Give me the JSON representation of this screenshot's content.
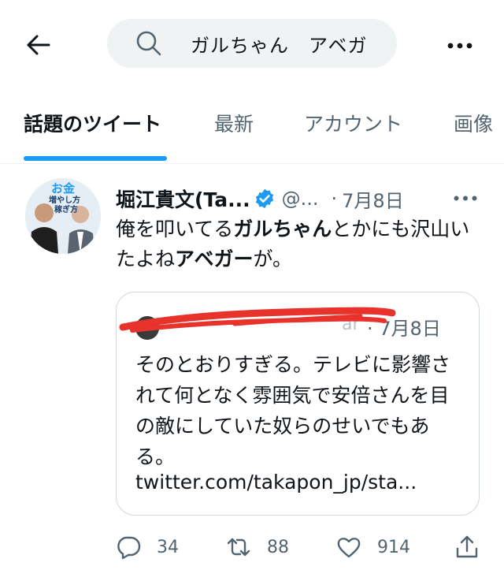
{
  "search": {
    "query": "ガルちゃん　アベガ"
  },
  "tabs": [
    {
      "label": "話題のツイート"
    },
    {
      "label": "最新"
    },
    {
      "label": "アカウント"
    },
    {
      "label": "画像"
    }
  ],
  "tweet": {
    "author_name": "堀江貴文(Ta...",
    "handle": "@...",
    "separator": "·",
    "date": "7月8日",
    "text_parts": [
      "俺を叩いてる",
      "ガルちゃん",
      "とかにも沢山いたよね",
      "アベガー",
      "が。"
    ],
    "avatar_text": {
      "line1": "お金",
      "line2": "増やし方",
      "line3": "稼ぎ方"
    },
    "quote": {
      "partial_name": "ar",
      "separator": "·",
      "date": "7月8日",
      "text": "そのとおりすぎる。テレビに影響されて何となく雰囲気で安倍さんを目の敵にしていた奴らのせいでもある。",
      "link": "twitter.com/takapon_jp/sta..."
    },
    "stats": {
      "replies": "34",
      "retweets": "88",
      "likes": "914"
    }
  },
  "colors": {
    "accent": "#1d9bf0",
    "text_primary": "#0f1419",
    "text_secondary": "#536471",
    "search_bg": "#eff3f4",
    "redaction": "#e8322c"
  },
  "icons": [
    "back-arrow-icon",
    "search-icon",
    "more-icon",
    "verified-icon",
    "reply-icon",
    "retweet-icon",
    "like-icon",
    "share-icon"
  ]
}
